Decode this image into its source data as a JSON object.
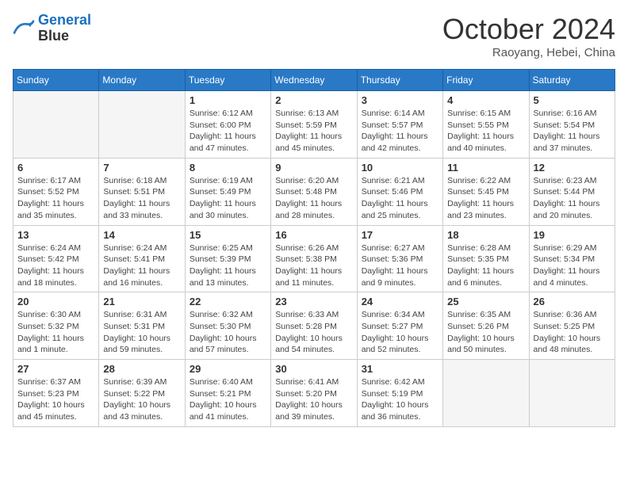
{
  "header": {
    "logo_line1": "General",
    "logo_line2": "Blue",
    "month": "October 2024",
    "location": "Raoyang, Hebei, China"
  },
  "weekdays": [
    "Sunday",
    "Monday",
    "Tuesday",
    "Wednesday",
    "Thursday",
    "Friday",
    "Saturday"
  ],
  "weeks": [
    [
      {
        "day": "",
        "info": ""
      },
      {
        "day": "",
        "info": ""
      },
      {
        "day": "1",
        "info": "Sunrise: 6:12 AM\nSunset: 6:00 PM\nDaylight: 11 hours and 47 minutes."
      },
      {
        "day": "2",
        "info": "Sunrise: 6:13 AM\nSunset: 5:59 PM\nDaylight: 11 hours and 45 minutes."
      },
      {
        "day": "3",
        "info": "Sunrise: 6:14 AM\nSunset: 5:57 PM\nDaylight: 11 hours and 42 minutes."
      },
      {
        "day": "4",
        "info": "Sunrise: 6:15 AM\nSunset: 5:55 PM\nDaylight: 11 hours and 40 minutes."
      },
      {
        "day": "5",
        "info": "Sunrise: 6:16 AM\nSunset: 5:54 PM\nDaylight: 11 hours and 37 minutes."
      }
    ],
    [
      {
        "day": "6",
        "info": "Sunrise: 6:17 AM\nSunset: 5:52 PM\nDaylight: 11 hours and 35 minutes."
      },
      {
        "day": "7",
        "info": "Sunrise: 6:18 AM\nSunset: 5:51 PM\nDaylight: 11 hours and 33 minutes."
      },
      {
        "day": "8",
        "info": "Sunrise: 6:19 AM\nSunset: 5:49 PM\nDaylight: 11 hours and 30 minutes."
      },
      {
        "day": "9",
        "info": "Sunrise: 6:20 AM\nSunset: 5:48 PM\nDaylight: 11 hours and 28 minutes."
      },
      {
        "day": "10",
        "info": "Sunrise: 6:21 AM\nSunset: 5:46 PM\nDaylight: 11 hours and 25 minutes."
      },
      {
        "day": "11",
        "info": "Sunrise: 6:22 AM\nSunset: 5:45 PM\nDaylight: 11 hours and 23 minutes."
      },
      {
        "day": "12",
        "info": "Sunrise: 6:23 AM\nSunset: 5:44 PM\nDaylight: 11 hours and 20 minutes."
      }
    ],
    [
      {
        "day": "13",
        "info": "Sunrise: 6:24 AM\nSunset: 5:42 PM\nDaylight: 11 hours and 18 minutes."
      },
      {
        "day": "14",
        "info": "Sunrise: 6:24 AM\nSunset: 5:41 PM\nDaylight: 11 hours and 16 minutes."
      },
      {
        "day": "15",
        "info": "Sunrise: 6:25 AM\nSunset: 5:39 PM\nDaylight: 11 hours and 13 minutes."
      },
      {
        "day": "16",
        "info": "Sunrise: 6:26 AM\nSunset: 5:38 PM\nDaylight: 11 hours and 11 minutes."
      },
      {
        "day": "17",
        "info": "Sunrise: 6:27 AM\nSunset: 5:36 PM\nDaylight: 11 hours and 9 minutes."
      },
      {
        "day": "18",
        "info": "Sunrise: 6:28 AM\nSunset: 5:35 PM\nDaylight: 11 hours and 6 minutes."
      },
      {
        "day": "19",
        "info": "Sunrise: 6:29 AM\nSunset: 5:34 PM\nDaylight: 11 hours and 4 minutes."
      }
    ],
    [
      {
        "day": "20",
        "info": "Sunrise: 6:30 AM\nSunset: 5:32 PM\nDaylight: 11 hours and 1 minute."
      },
      {
        "day": "21",
        "info": "Sunrise: 6:31 AM\nSunset: 5:31 PM\nDaylight: 10 hours and 59 minutes."
      },
      {
        "day": "22",
        "info": "Sunrise: 6:32 AM\nSunset: 5:30 PM\nDaylight: 10 hours and 57 minutes."
      },
      {
        "day": "23",
        "info": "Sunrise: 6:33 AM\nSunset: 5:28 PM\nDaylight: 10 hours and 54 minutes."
      },
      {
        "day": "24",
        "info": "Sunrise: 6:34 AM\nSunset: 5:27 PM\nDaylight: 10 hours and 52 minutes."
      },
      {
        "day": "25",
        "info": "Sunrise: 6:35 AM\nSunset: 5:26 PM\nDaylight: 10 hours and 50 minutes."
      },
      {
        "day": "26",
        "info": "Sunrise: 6:36 AM\nSunset: 5:25 PM\nDaylight: 10 hours and 48 minutes."
      }
    ],
    [
      {
        "day": "27",
        "info": "Sunrise: 6:37 AM\nSunset: 5:23 PM\nDaylight: 10 hours and 45 minutes."
      },
      {
        "day": "28",
        "info": "Sunrise: 6:39 AM\nSunset: 5:22 PM\nDaylight: 10 hours and 43 minutes."
      },
      {
        "day": "29",
        "info": "Sunrise: 6:40 AM\nSunset: 5:21 PM\nDaylight: 10 hours and 41 minutes."
      },
      {
        "day": "30",
        "info": "Sunrise: 6:41 AM\nSunset: 5:20 PM\nDaylight: 10 hours and 39 minutes."
      },
      {
        "day": "31",
        "info": "Sunrise: 6:42 AM\nSunset: 5:19 PM\nDaylight: 10 hours and 36 minutes."
      },
      {
        "day": "",
        "info": ""
      },
      {
        "day": "",
        "info": ""
      }
    ]
  ]
}
